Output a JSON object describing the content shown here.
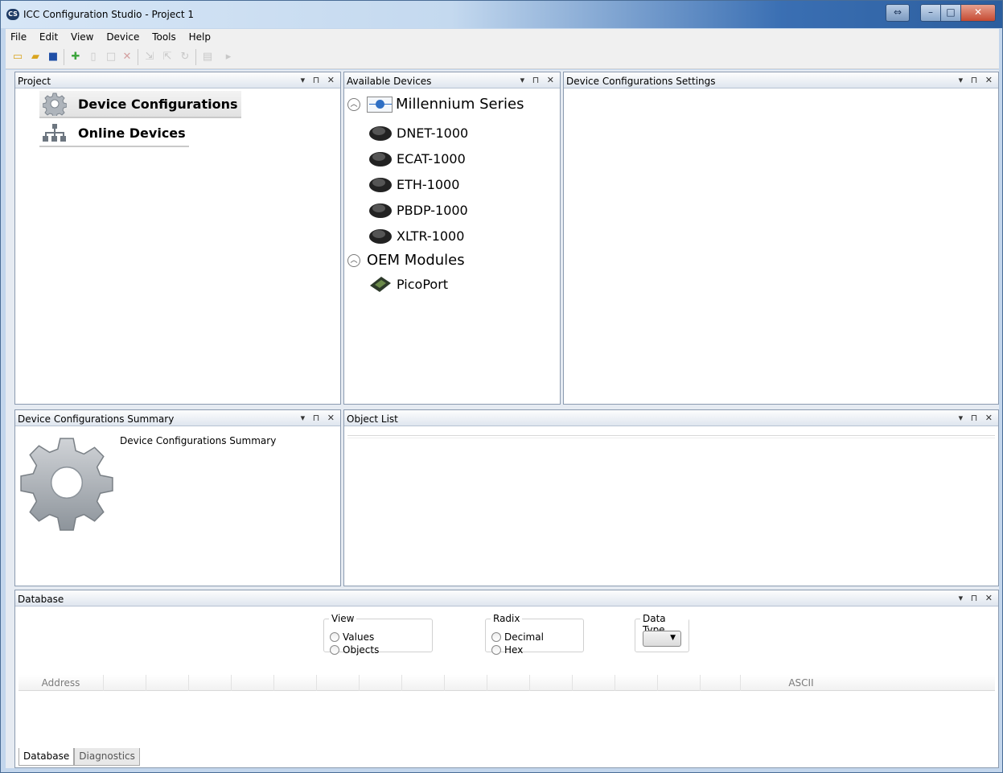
{
  "window": {
    "title": "ICC Configuration Studio - Project 1",
    "app_icon": "CS"
  },
  "menu": [
    "File",
    "Edit",
    "View",
    "Device",
    "Tools",
    "Help"
  ],
  "panels": {
    "project": {
      "title": "Project",
      "items": [
        {
          "label": "Device Configurations",
          "icon": "gear-icon",
          "selected": true
        },
        {
          "label": "Online Devices",
          "icon": "network-tree-icon",
          "selected": false
        }
      ]
    },
    "available_devices": {
      "title": "Available Devices",
      "groups": [
        {
          "label": "Millennium Series",
          "icon": "millennium-series-icon",
          "devices": [
            "DNET-1000",
            "ECAT-1000",
            "ETH-1000",
            "PBDP-1000",
            "XLTR-1000"
          ]
        },
        {
          "label": "OEM Modules",
          "devices": [
            "PicoPort"
          ]
        }
      ]
    },
    "settings": {
      "title": "Device Configurations Settings"
    },
    "summary": {
      "title": "Device Configurations Summary",
      "content_title": "Device Configurations Summary"
    },
    "object_list": {
      "title": "Object List"
    },
    "database": {
      "title": "Database",
      "view": {
        "legend": "View",
        "options": [
          "Values",
          "Objects"
        ]
      },
      "radix": {
        "legend": "Radix",
        "options": [
          "Decimal",
          "Hex"
        ]
      },
      "data_type": {
        "legend": "Data Type"
      },
      "columns": {
        "address": "Address",
        "ascii": "ASCII"
      },
      "tabs": [
        "Database",
        "Diagnostics"
      ]
    }
  },
  "panel_controls": "▾ ⊓ ✕"
}
